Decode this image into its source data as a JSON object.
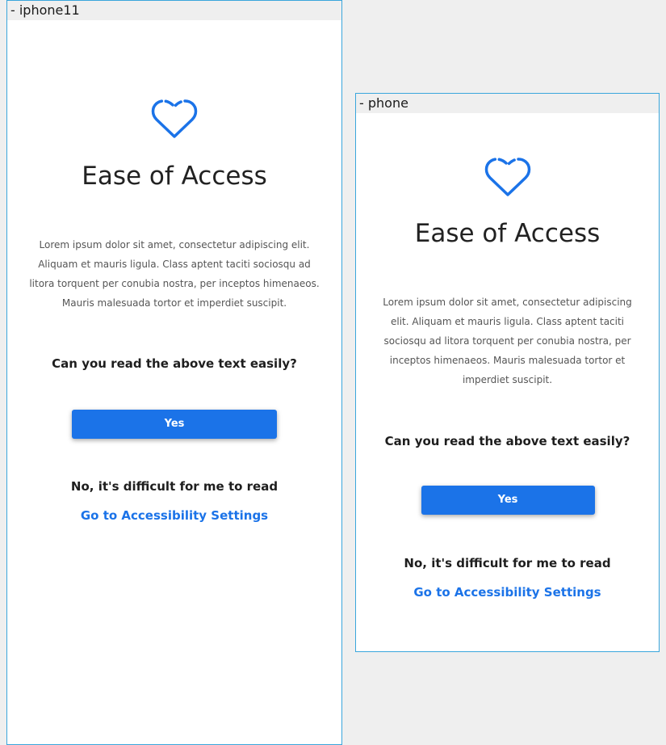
{
  "colors": {
    "accent": "#1b73e8",
    "frame_border": "#3aa6dc",
    "canvas": "#efefef",
    "title_text": "#222222",
    "body_text": "#555555"
  },
  "frames": [
    {
      "label": "- iphone11",
      "icon": "heart-icon",
      "title": "Ease of Access",
      "body": "Lorem ipsum dolor sit amet, consectetur adipiscing elit. Aliquam et mauris ligula. Class aptent taciti sociosqu ad litora torquent per conubia nostra, per inceptos himenaeos. Mauris malesuada tortor et imperdiet suscipit.",
      "question": "Can you read the above text easily?",
      "yes_label": "Yes",
      "difficult_text": "No, it's difficult for me to read",
      "settings_link": "Go to Accessibility Settings"
    },
    {
      "label": "- phone",
      "icon": "heart-icon",
      "title": "Ease of Access",
      "body": "Lorem ipsum dolor sit amet, consectetur adipiscing elit. Aliquam et mauris ligula. Class aptent taciti sociosqu ad litora torquent per conubia nostra, per inceptos himenaeos. Mauris malesuada tortor et imperdiet suscipit.",
      "question": "Can you read the above text easily?",
      "yes_label": "Yes",
      "difficult_text": "No, it's difficult for me to read",
      "settings_link": "Go to Accessibility Settings"
    }
  ]
}
